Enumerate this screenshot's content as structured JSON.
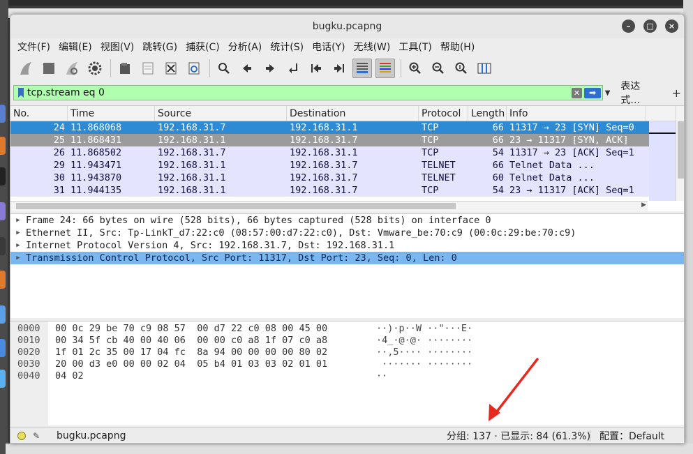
{
  "window": {
    "title": "bugku.pcapng"
  },
  "menu": [
    "文件(F)",
    "编辑(E)",
    "视图(V)",
    "跳转(G)",
    "捕获(C)",
    "分析(A)",
    "统计(S)",
    "电话(Y)",
    "无线(W)",
    "工具(T)",
    "帮助(H)"
  ],
  "toolbar": {
    "icons": [
      "shark-fin-start-icon",
      "stop-square-icon",
      "restart-fin-icon",
      "gear-options-icon",
      "open-folder-icon",
      "file-icon",
      "close-file-icon",
      "reload-icon",
      "magnifier-icon",
      "arrow-left-icon",
      "arrow-right-icon",
      "goto-packet-icon",
      "first-packet-icon",
      "last-packet-icon",
      "autoscroll-icon",
      "colorize-icon",
      "zoom-in-icon",
      "zoom-out-icon",
      "zoom-normal-icon",
      "resize-columns-icon"
    ]
  },
  "filter": {
    "value": "tcp.stream eq 0",
    "expression_label": "表达式…",
    "plus_label": "+"
  },
  "packet_list": {
    "columns": [
      "No.",
      "Time",
      "Source",
      "Destination",
      "Protocol",
      "Length",
      "Info"
    ],
    "rows": [
      {
        "no": "24",
        "time": "11.868068",
        "src": "192.168.31.7",
        "dst": "192.168.31.1",
        "proto": "TCP",
        "len": "66",
        "info": "11317 → 23 [SYN] Seq=0",
        "style": "sel"
      },
      {
        "no": "25",
        "time": "11.868431",
        "src": "192.168.31.1",
        "dst": "192.168.31.7",
        "proto": "TCP",
        "len": "66",
        "info": "23 → 11317 [SYN, ACK]",
        "style": "rel"
      },
      {
        "no": "26",
        "time": "11.868502",
        "src": "192.168.31.7",
        "dst": "192.168.31.1",
        "proto": "TCP",
        "len": "54",
        "info": "11317 → 23 [ACK] Seq=1",
        "style": "tcp"
      },
      {
        "no": "29",
        "time": "11.943471",
        "src": "192.168.31.1",
        "dst": "192.168.31.7",
        "proto": "TELNET",
        "len": "66",
        "info": "Telnet Data ...",
        "style": "tel"
      },
      {
        "no": "30",
        "time": "11.943870",
        "src": "192.168.31.1",
        "dst": "192.168.31.7",
        "proto": "TELNET",
        "len": "60",
        "info": "Telnet Data ...",
        "style": "tel"
      },
      {
        "no": "31",
        "time": "11.944135",
        "src": "192.168.31.1",
        "dst": "192.168.31.7",
        "proto": "TCP",
        "len": "54",
        "info": "23 → 11317 [ACK] Seq=1",
        "style": "tcp"
      }
    ]
  },
  "details": [
    "Frame 24: 66 bytes on wire (528 bits), 66 bytes captured (528 bits) on interface 0",
    "Ethernet II, Src: Tp-LinkT_d7:22:c0 (08:57:00:d7:22:c0), Dst: Vmware_be:70:c9 (00:0c:29:be:70:c9)",
    "Internet Protocol Version 4, Src: 192.168.31.7, Dst: 192.168.31.1",
    "Transmission Control Protocol, Src Port: 11317, Dst Port: 23, Seq: 0, Len: 0"
  ],
  "bytes": [
    {
      "off": "0000",
      "hex": "00 0c 29 be 70 c9 08 57  00 d7 22 c0 08 00 45 00",
      "ascii": "··)·p··W ··\"···E·"
    },
    {
      "off": "0010",
      "hex": "00 34 5f cb 40 00 40 06  00 00 c0 a8 1f 07 c0 a8",
      "ascii": "·4_·@·@· ········"
    },
    {
      "off": "0020",
      "hex": "1f 01 2c 35 00 17 04 fc  8a 94 00 00 00 00 80 02",
      "ascii": "··,5···· ········"
    },
    {
      "off": "0030",
      "hex": "20 00 d3 e0 00 00 02 04  05 b4 01 03 03 02 01 01",
      "ascii": " ······· ········"
    },
    {
      "off": "0040",
      "hex": "04 02",
      "ascii": "··"
    }
  ],
  "status": {
    "file": "bugku.pcapng",
    "stats": "分组: 137 · 已显示: 84 (61.3%)",
    "profile": "配置：Default"
  },
  "colors": {
    "selected_row": "#2f8ad4",
    "related_row": "#9b9b9b",
    "tcp_row": "#e4e4ff",
    "filter_valid": "#afffaf",
    "annotation_arrow": "#e8281c"
  }
}
